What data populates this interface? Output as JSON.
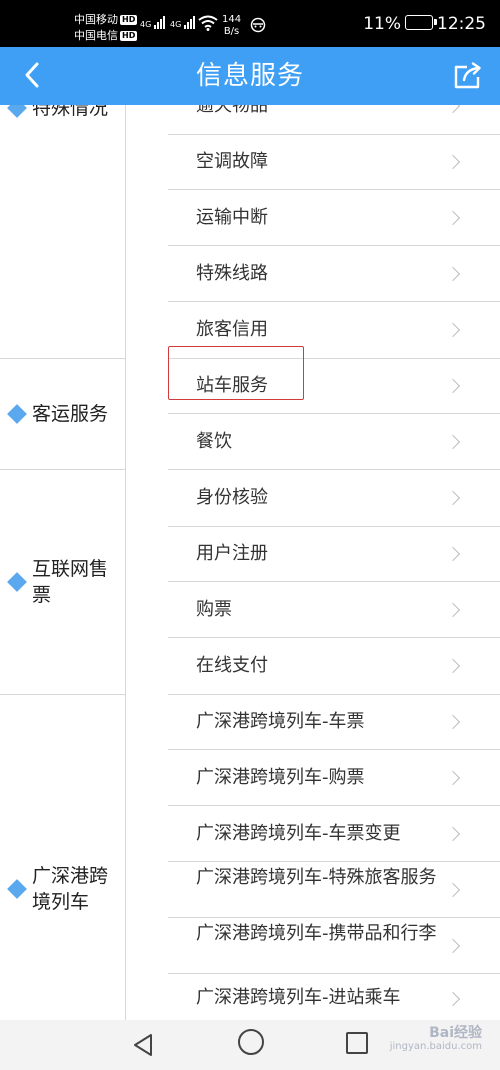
{
  "status_bar": {
    "carrier1": "中国移动",
    "carrier2": "中国电信",
    "hd": "HD",
    "network1": "4G",
    "network2": "4G",
    "speed_value": "144",
    "speed_unit": "B/s",
    "battery": "11%",
    "time": "12:25"
  },
  "header": {
    "title": "信息服务",
    "back_icon": "chevron-left-icon",
    "share_icon": "share-icon"
  },
  "categories": [
    {
      "label": "特殊情况"
    },
    {
      "label": "客运服务"
    },
    {
      "label": "互联网售票"
    },
    {
      "label": "广深港跨境列车"
    }
  ],
  "items": [
    {
      "label": "逾天物品"
    },
    {
      "label": "空调故障"
    },
    {
      "label": "运输中断"
    },
    {
      "label": "特殊线路"
    },
    {
      "label": "旅客信用"
    },
    {
      "label": "站车服务"
    },
    {
      "label": "餐饮"
    },
    {
      "label": "身份核验"
    },
    {
      "label": "用户注册"
    },
    {
      "label": "购票"
    },
    {
      "label": "在线支付"
    },
    {
      "label": "广深港跨境列车-车票"
    },
    {
      "label": "广深港跨境列车-购票"
    },
    {
      "label": "广深港跨境列车-车票变更"
    },
    {
      "label": "广深港跨境列车-特殊旅客服务"
    },
    {
      "label": "广深港跨境列车-携带品和行李"
    },
    {
      "label": "广深港跨境列车-进站乘车"
    }
  ],
  "watermark": {
    "brand": "Bai经验",
    "url": "jingyan.baidu.com"
  },
  "colors": {
    "header_bg": "#3e9ff5",
    "diamond": "#5aa8ee",
    "highlight_border": "#d23b3b"
  }
}
